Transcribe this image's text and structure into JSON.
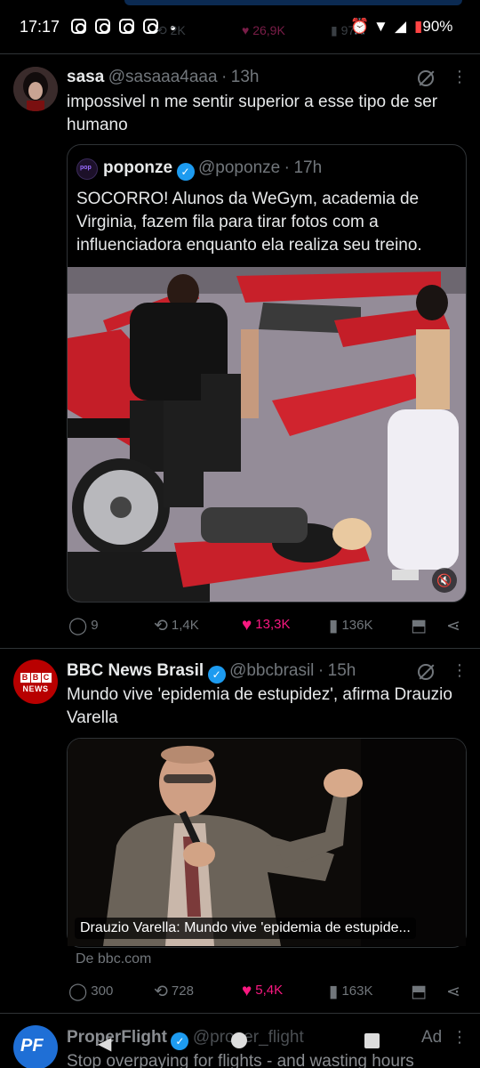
{
  "status_bar": {
    "time": "17:17",
    "ghost_retweets": "2K",
    "ghost_likes": "26,9K",
    "ghost_views": "97K",
    "battery": "90%"
  },
  "tweet1": {
    "name": "sasa",
    "handle": "@sasaaa4aaa",
    "time": "13h",
    "text": "impossivel n me sentir superior a esse tipo de ser humano",
    "quote": {
      "name": "poponze",
      "handle": "@poponze",
      "time": "17h",
      "text": "SOCORRO! Alunos da WeGym, academia de Virginia, fazem fila para tirar fotos com a influenciadora enquanto ela realiza seu treino."
    },
    "actions": {
      "replies": "9",
      "retweets": "1,4K",
      "likes": "13,3K",
      "views": "136K"
    }
  },
  "tweet2": {
    "name": "BBC News Brasil",
    "handle": "@bbcbrasil",
    "time": "15h",
    "text": "Mundo vive 'epidemia de estupidez', afirma Drauzio Varella",
    "card_caption": "Drauzio Varella: Mundo vive 'epidemia de estupide...",
    "source": "De bbc.com",
    "actions": {
      "replies": "300",
      "retweets": "728",
      "likes": "5,4K",
      "views": "163K"
    }
  },
  "tweet3": {
    "name": "ProperFlight",
    "handle": "@proper_flight",
    "ad_label": "Ad",
    "text": "Stop overpaying for flights - and wasting hours"
  },
  "icons": {
    "reply": "speech-bubble",
    "retweet": "retweet-arrows",
    "like": "heart",
    "views": "bar-chart",
    "bookmark": "bookmark",
    "share": "share"
  },
  "colors": {
    "like_active": "#f91880",
    "verified": "#1d9bf0",
    "bbc_red": "#b80000"
  }
}
